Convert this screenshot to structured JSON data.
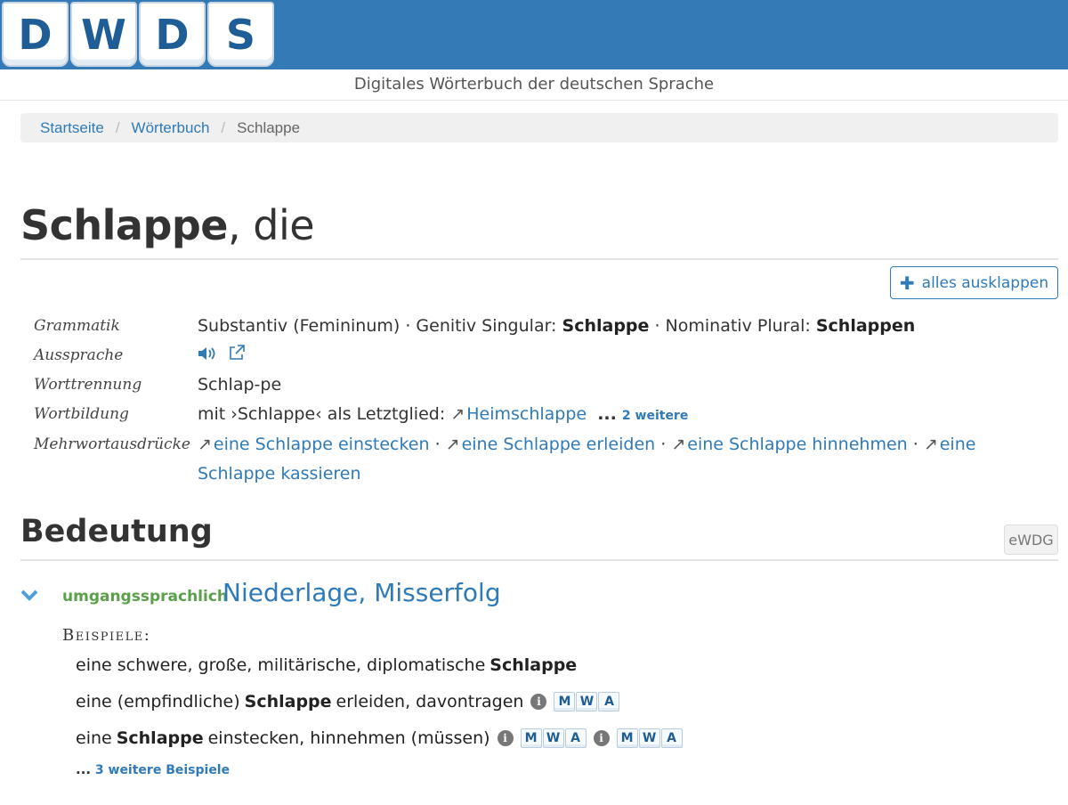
{
  "header": {
    "logo_letters": [
      "D",
      "W",
      "D",
      "S"
    ],
    "subtitle": "Digitales Wörterbuch der deutschen Sprache",
    "brand_color": "#337ab7"
  },
  "breadcrumb": {
    "items": [
      "Startseite",
      "Wörterbuch"
    ],
    "current": "Schlappe",
    "separator": "/"
  },
  "entry": {
    "lemma": "Schlappe",
    "article": ", die",
    "expand_label": "alles ausklappen"
  },
  "info": {
    "grammatik_label": "Grammatik",
    "grammatik_text1": "Substantiv (Femininum) · Genitiv Singular:",
    "grammatik_gen": "Schlappe",
    "grammatik_text2": "· Nominativ Plural:",
    "grammatik_pl": "Schlappen",
    "aussprache_label": "Aussprache",
    "worttrennung_label": "Worttrennung",
    "worttrennung": "Schlap-pe",
    "wortbildung_label": "Wortbildung",
    "wortbildung_text": "mit ›Schlappe‹ als Letztglied:",
    "wortbildung_link": "Heimschlappe",
    "wortbildung_more_dots": "...",
    "wortbildung_more": "2 weitere",
    "mwa_label": "Mehrwortausdrücke",
    "mwa_links": [
      "eine Schlappe einstecken",
      "eine Schlappe erleiden",
      "eine Schlappe hinnehmen",
      "eine Schlappe kassieren"
    ]
  },
  "bedeutung": {
    "heading": "Bedeutung",
    "source_badge": "eWDG",
    "register": "umgangssprachlich",
    "meaning": "Niederlage, Misserfolg",
    "examples_label": "Beispiele:",
    "examples": [
      {
        "pre": "eine schwere, große, militärische, diplomatische",
        "bold": "Schlappe",
        "post": ""
      },
      {
        "pre": "eine (empfindliche)",
        "bold": "Schlappe",
        "post": "erleiden, davontragen"
      },
      {
        "pre": "eine",
        "bold": "Schlappe",
        "post": "einstecken, hinnehmen (müssen)"
      }
    ],
    "mwa_letters": [
      "M",
      "W",
      "A"
    ],
    "more_dots": "...",
    "more_examples": "3 weitere Beispiele"
  }
}
